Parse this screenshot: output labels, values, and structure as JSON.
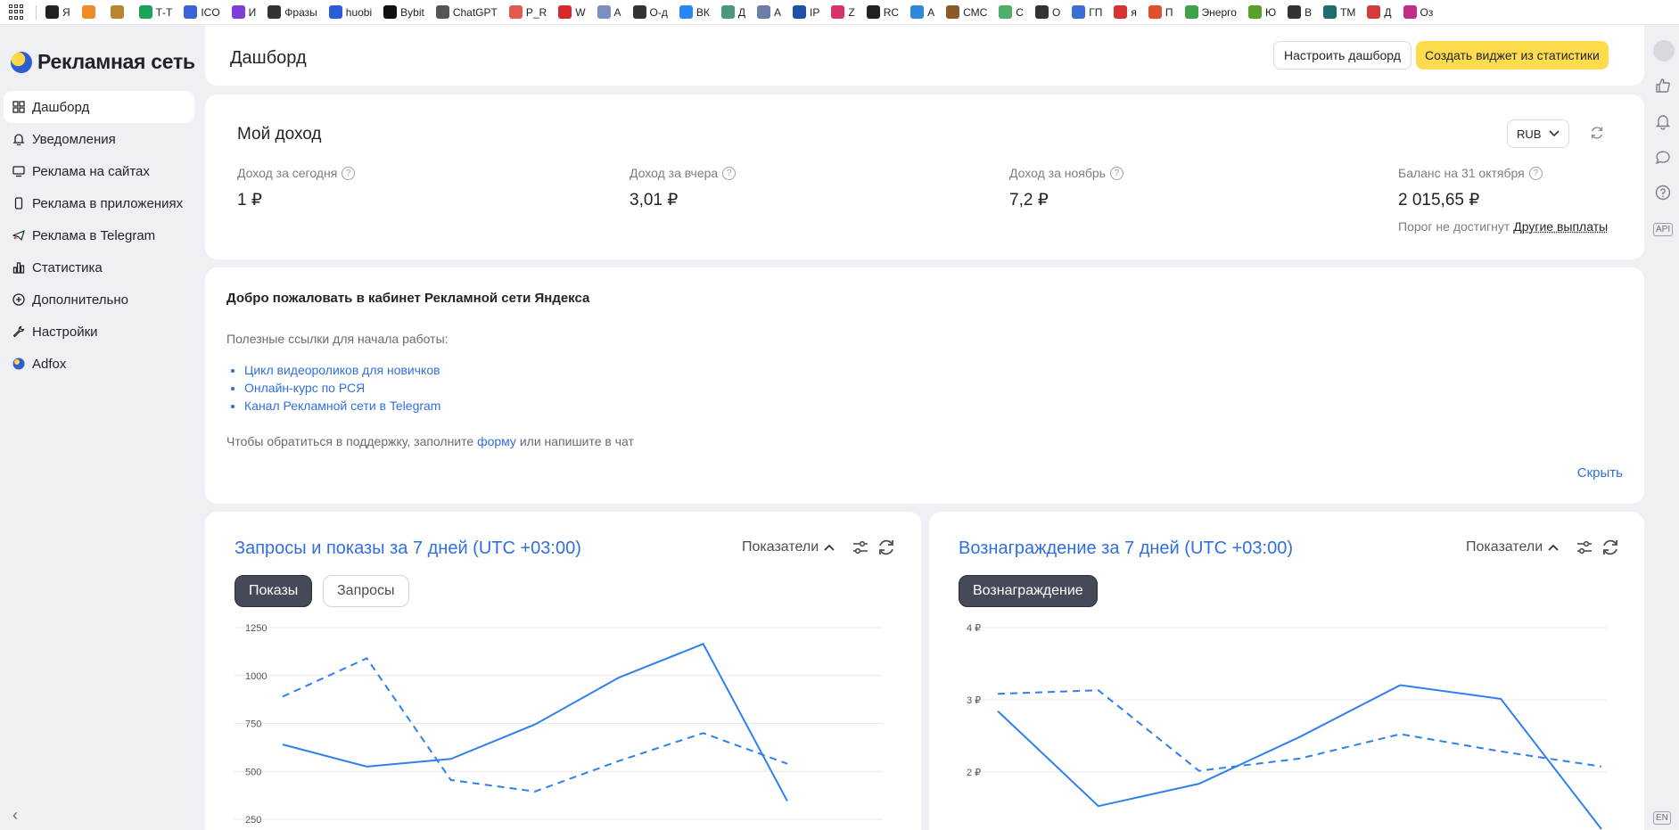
{
  "bookmarks": [
    {
      "label": "Я",
      "color": "#222222"
    },
    {
      "label": "",
      "color": "#f08a24"
    },
    {
      "label": "",
      "color": "#b8862f"
    },
    {
      "label": "Т-Т",
      "color": "#1aa35b"
    },
    {
      "label": "ICO",
      "color": "#3b63d6"
    },
    {
      "label": "И",
      "color": "#7e3fd9"
    },
    {
      "label": "Фразы",
      "color": "#333333"
    },
    {
      "label": "huobi",
      "color": "#2b5bd7"
    },
    {
      "label": "Bybit",
      "color": "#111111"
    },
    {
      "label": "ChatGPT",
      "color": "#555555"
    },
    {
      "label": "P_R",
      "color": "#e05a4d"
    },
    {
      "label": "W",
      "color": "#d62b2b"
    },
    {
      "label": "A",
      "color": "#7b8fc2"
    },
    {
      "label": "О-д",
      "color": "#333333"
    },
    {
      "label": "ВК",
      "color": "#2787f5"
    },
    {
      "label": "Д",
      "color": "#4a9a7a"
    },
    {
      "label": "A",
      "color": "#6c7ea8"
    },
    {
      "label": "IP",
      "color": "#1f4fa8"
    },
    {
      "label": "Z",
      "color": "#d9336b"
    },
    {
      "label": "RC",
      "color": "#222222"
    },
    {
      "label": "A",
      "color": "#2f88d8"
    },
    {
      "label": "СМС",
      "color": "#8a5a2a"
    },
    {
      "label": "С",
      "color": "#4fae6a"
    },
    {
      "label": "О",
      "color": "#333333"
    },
    {
      "label": "ГП",
      "color": "#3b6fd6"
    },
    {
      "label": "я",
      "color": "#d63333"
    },
    {
      "label": "П",
      "color": "#e0502f"
    },
    {
      "label": "Энерго",
      "color": "#3fa34a"
    },
    {
      "label": "Ю",
      "color": "#5aa02c"
    },
    {
      "label": "В",
      "color": "#333333"
    },
    {
      "label": "ТМ",
      "color": "#1c6e6e"
    },
    {
      "label": "Д",
      "color": "#d23c3c"
    },
    {
      "label": "Оз",
      "color": "#c02e8a"
    }
  ],
  "sidebar": {
    "logo_text": "Рекламная сеть",
    "items": [
      {
        "label": "Дашборд",
        "icon": "dashboard-icon",
        "active": true
      },
      {
        "label": "Уведомления",
        "icon": "bell-icon",
        "active": false
      },
      {
        "label": "Реклама на сайтах",
        "icon": "monitor-icon",
        "active": false
      },
      {
        "label": "Реклама в приложениях",
        "icon": "phone-icon",
        "active": false
      },
      {
        "label": "Реклама в Telegram",
        "icon": "telegram-icon",
        "active": false
      },
      {
        "label": "Статистика",
        "icon": "bar-chart-icon",
        "active": false
      },
      {
        "label": "Дополнительно",
        "icon": "plus-circle-icon",
        "active": false
      },
      {
        "label": "Настройки",
        "icon": "wrench-icon",
        "active": false
      },
      {
        "label": "Adfox",
        "icon": "adfox-icon",
        "active": false
      }
    ]
  },
  "header": {
    "title": "Дашборд",
    "configure_label": "Настроить дашборд",
    "create_widget_label": "Создать виджет из статистики"
  },
  "income": {
    "title": "Мой доход",
    "currency": "RUB",
    "metrics": [
      {
        "label": "Доход за сегодня",
        "value": "1 ₽"
      },
      {
        "label": "Доход за вчера",
        "value": "3,01 ₽"
      },
      {
        "label": "Доход за ноябрь",
        "value": "7,2 ₽"
      },
      {
        "label": "Баланс на 31 октября",
        "value": "2 015,65 ₽"
      }
    ],
    "threshold_text": "Порог не достигнут",
    "other_payouts_label": "Другие выплаты"
  },
  "welcome": {
    "title": "Добро пожаловать в кабинет Рекламной сети Яндекса",
    "subtitle": "Полезные ссылки для начала работы:",
    "links": [
      "Цикл видеороликов для новичков",
      "Онлайн-курс по РСЯ",
      "Канал Рекламной сети в Telegram"
    ],
    "support_prefix": "Чтобы обратиться в поддержку, заполните",
    "support_link": "форму",
    "support_suffix": "или напишите в чат",
    "hide_label": "Скрыть"
  },
  "charts": {
    "left": {
      "title": "Запросы и показы за 7 дней (UTC +03:00)",
      "metrics_label": "Показатели",
      "chips": [
        "Показы",
        "Запросы"
      ]
    },
    "right": {
      "title": "Вознаграждение за 7 дней (UTC +03:00)",
      "metrics_label": "Показатели",
      "chips": [
        "Вознаграждение"
      ]
    }
  },
  "chart_data": [
    {
      "type": "line",
      "title": "Запросы и показы за 7 дней (UTC +03:00)",
      "y_ticks": [
        "1250",
        "1000",
        "750",
        "500",
        "250"
      ],
      "ylim": [
        250,
        1250
      ],
      "x": [
        1,
        2,
        3,
        4,
        5,
        6,
        7
      ],
      "series": [
        {
          "style": "solid",
          "values": [
            640,
            525,
            565,
            745,
            990,
            1165,
            345
          ]
        },
        {
          "style": "dashed",
          "values": [
            890,
            1090,
            455,
            395,
            555,
            700,
            540
          ]
        }
      ],
      "color": "#2f80ed"
    },
    {
      "type": "line",
      "title": "Вознаграждение за 7 дней (UTC +03:00)",
      "y_ticks": [
        "4 ₽",
        "3 ₽",
        "2 ₽"
      ],
      "ylim": [
        1.2,
        4
      ],
      "x": [
        1,
        2,
        3,
        4,
        5,
        6,
        7
      ],
      "series": [
        {
          "style": "solid",
          "values": [
            2.84,
            1.52,
            1.83,
            2.48,
            3.2,
            3.01,
            1.2
          ]
        },
        {
          "style": "dashed",
          "values": [
            3.08,
            3.13,
            2.01,
            2.18,
            2.52,
            2.28,
            2.07
          ]
        }
      ],
      "color": "#2f80ed"
    }
  ],
  "rail": {
    "api_label": "API",
    "lang_label": "EN"
  }
}
